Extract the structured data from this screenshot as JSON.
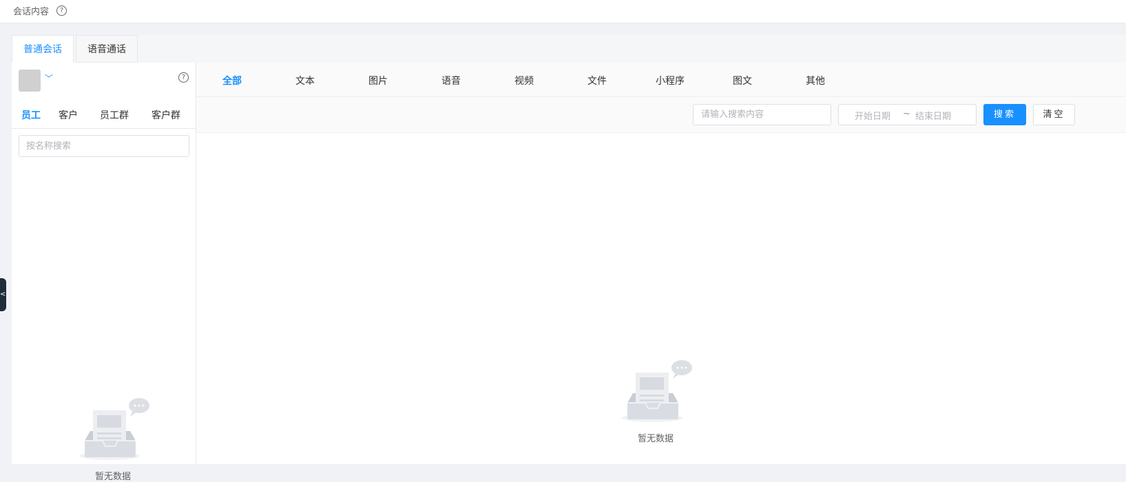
{
  "header": {
    "title": "会话内容",
    "help_icon": "question-circle-icon"
  },
  "tabs": [
    {
      "label": "普通会话",
      "active": true
    },
    {
      "label": "语音通话",
      "active": false
    }
  ],
  "left_panel": {
    "help_icon": "question-circle-icon",
    "chevron_icon": "chevron-down-icon",
    "tabs": [
      {
        "label": "员工",
        "active": true
      },
      {
        "label": "客户",
        "active": false
      },
      {
        "label": "员工群",
        "active": false
      },
      {
        "label": "客户群",
        "active": false
      }
    ],
    "search_placeholder": "按名称搜索",
    "empty_text": "暂无数据"
  },
  "main": {
    "type_tabs": [
      {
        "label": "全部",
        "active": true
      },
      {
        "label": "文本",
        "active": false
      },
      {
        "label": "图片",
        "active": false
      },
      {
        "label": "语音",
        "active": false
      },
      {
        "label": "视频",
        "active": false
      },
      {
        "label": "文件",
        "active": false
      },
      {
        "label": "小程序",
        "active": false
      },
      {
        "label": "图文",
        "active": false
      },
      {
        "label": "其他",
        "active": false
      }
    ],
    "search_placeholder": "请输入搜索内容",
    "date_start_placeholder": "开始日期",
    "date_separator": "~",
    "date_end_placeholder": "结束日期",
    "search_button": "搜索",
    "clear_button": "清空",
    "empty_text": "暂无数据"
  },
  "colors": {
    "accent": "#1890ff",
    "sidebar_handle": "#1f2d3d"
  }
}
